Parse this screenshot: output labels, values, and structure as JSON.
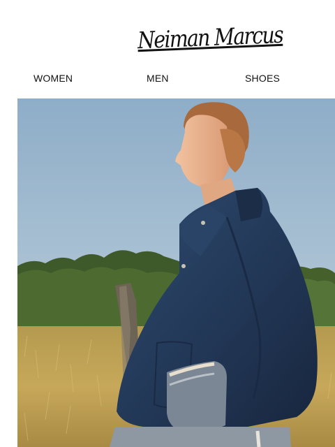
{
  "header": {
    "logo_text": "Neiman Marcus"
  },
  "nav": {
    "items": [
      {
        "label": "WOMEN"
      },
      {
        "label": "MEN"
      },
      {
        "label": "SHOES"
      }
    ]
  },
  "colors": {
    "background": "#ffffff",
    "text": "#111111",
    "sky": "#9cb8cf",
    "jacket": "#24395a"
  }
}
